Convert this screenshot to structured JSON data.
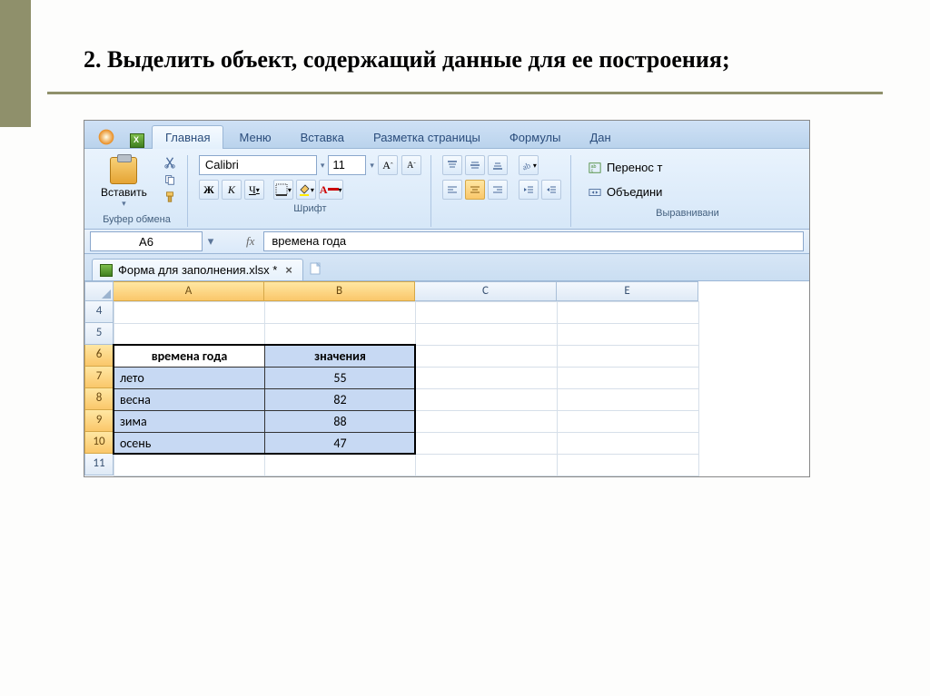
{
  "slide": {
    "title": "2. Выделить объект, содержащий данные для ее построения;"
  },
  "ribbon": {
    "tabs": [
      "Главная",
      "Меню",
      "Вставка",
      "Разметка страницы",
      "Формулы",
      "Дан"
    ],
    "paste_label": "Вставить",
    "clipboard_group": "Буфер обмена",
    "font_group": "Шрифт",
    "align_group": "Выравнивани",
    "font_name": "Calibri",
    "font_size": "11",
    "bold": "Ж",
    "italic": "К",
    "underline": "Ч",
    "grow_font": "A",
    "shrink_font": "A",
    "wrap_text": "Перенос т",
    "merge_center": "Объедини"
  },
  "formula": {
    "cell_ref": "A6",
    "fx": "fx",
    "value": "времена года"
  },
  "doc": {
    "name": "Форма для заполнения.xlsx *"
  },
  "grid": {
    "cols": [
      "A",
      "B",
      "C",
      "E"
    ],
    "rows": [
      "4",
      "5",
      "6",
      "7",
      "8",
      "9",
      "10",
      "11"
    ],
    "header_a": "времена года",
    "header_b": "значения",
    "r7a": "лето",
    "r7b": "55",
    "r8a": "весна",
    "r8b": "82",
    "r9a": "зима",
    "r9b": "88",
    "r10a": "осень",
    "r10b": "47"
  },
  "chart_data": {
    "type": "table",
    "title": "времена года / значения",
    "categories": [
      "лето",
      "весна",
      "зима",
      "осень"
    ],
    "values": [
      55,
      82,
      88,
      47
    ]
  }
}
